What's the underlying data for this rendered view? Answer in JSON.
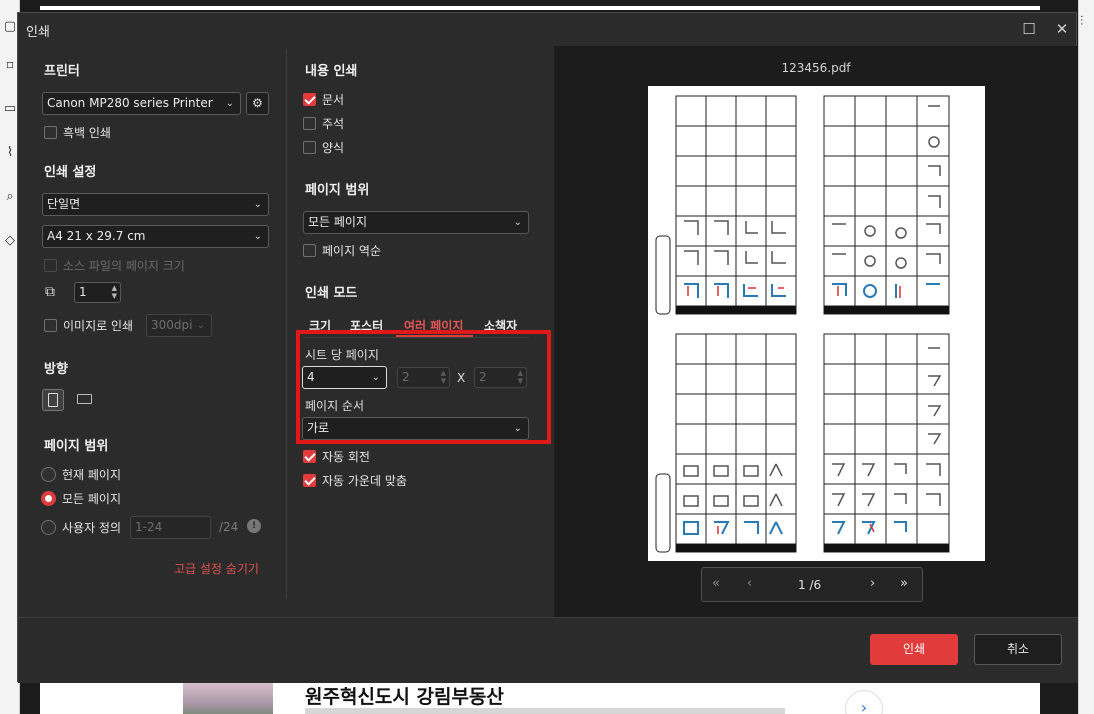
{
  "background_app": {
    "ad_title": "원주혁신도시 강림부동산",
    "ad_next_icon": "chevron-right-icon"
  },
  "dialog": {
    "title": "인쇄",
    "printer": {
      "section_title": "프린터",
      "selected": "Canon MP280 series Printer",
      "grayscale_label": "흑백 인쇄",
      "grayscale_checked": false
    },
    "print_settings": {
      "section_title": "인쇄 설정",
      "duplex": "단일면",
      "paper_size": "A4 21 x 29.7 cm",
      "source_size_label": "소스 파일의 페이지 크기",
      "copies": "1",
      "print_as_image_label": "이미지로 인쇄",
      "dpi": "300dpi"
    },
    "orientation": {
      "section_title": "방향"
    },
    "page_range_left": {
      "section_title": "페이지 범위",
      "current_page": "현재 페이지",
      "all_pages": "모든 페이지",
      "custom": "사용자 정의",
      "custom_placeholder": "1-24",
      "total": "/24",
      "selected": "모든 페이지"
    },
    "advanced_link": "고급 설정 숨기기",
    "content": {
      "section_title": "내용 인쇄",
      "document_label": "문서",
      "document_checked": true,
      "annotation_label": "주석",
      "annotation_checked": false,
      "form_label": "양식",
      "form_checked": false
    },
    "page_range_mid": {
      "section_title": "페이지 범위",
      "selected": "모든 페이지",
      "reverse_label": "페이지 역순"
    },
    "print_mode": {
      "section_title": "인쇄 모드",
      "tabs": [
        "크기",
        "포스터",
        "여러 페이지",
        "소책자"
      ],
      "active_tab": "여러 페이지",
      "pages_per_sheet_label": "시트 당 페이지",
      "pages_per_sheet": "4",
      "cols": "2",
      "x_label": "X",
      "rows": "2",
      "page_order_label": "페이지 순서",
      "page_order": "가로",
      "auto_rotate_label": "자동 회전",
      "auto_rotate_checked": true,
      "auto_center_label": "자동 가운데 맞춤",
      "auto_center_checked": true
    },
    "preview": {
      "file_name": "123456.pdf",
      "page_indicator": "1 /6"
    },
    "buttons": {
      "print": "인쇄",
      "cancel": "취소"
    },
    "colors": {
      "accent": "#e23b3b",
      "highlight_box": "#e11818",
      "dialog_bg": "#2b2b2b",
      "preview_bg": "#1c1c1c"
    }
  }
}
